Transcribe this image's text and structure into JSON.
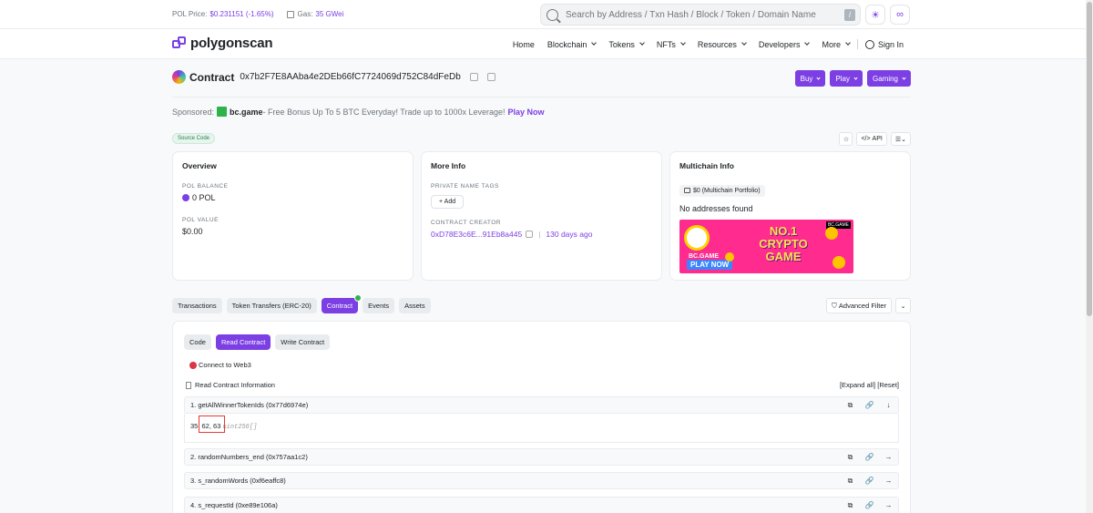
{
  "topbar": {
    "price_label": "POL Price:",
    "price_value": "$0.231151 (-1.65%)",
    "gas_label": "Gas:",
    "gas_value": "35 GWei",
    "search_placeholder": "Search by Address / Txn Hash / Block / Token / Domain Name",
    "search_shortcut": "/"
  },
  "header": {
    "logo": "polygonscan",
    "nav": [
      "Home",
      "Blockchain",
      "Tokens",
      "NFTs",
      "Resources",
      "Developers",
      "More"
    ],
    "signin": "Sign In"
  },
  "contract": {
    "label": "Contract",
    "address": "0x7b2F7E8AAba4e2DEb66fC7724069d752C84dFeDb",
    "actions": [
      "Buy",
      "Play",
      "Gaming"
    ]
  },
  "sponsored": {
    "prefix": "Sponsored:",
    "brand": "bc.game",
    "text": " - Free Bonus Up To 5 BTC Everyday! Trade up to 1000x Leverage!",
    "cta": "Play Now"
  },
  "badge": "Source Code",
  "tools": {
    "api": "API"
  },
  "overview": {
    "title": "Overview",
    "balance_label": "POL BALANCE",
    "balance_value": "0 POL",
    "value_label": "POL VALUE",
    "value_value": "$0.00"
  },
  "more_info": {
    "title": "More Info",
    "tags_label": "PRIVATE NAME TAGS",
    "add_label": "+ Add",
    "creator_label": "CONTRACT CREATOR",
    "creator_addr": "0xD78E3c6E...91Eb8a445",
    "creator_sep": "|",
    "creator_age": "130 days ago"
  },
  "multichain": {
    "title": "Multichain Info",
    "portfolio": "$0 (Multichain Portfolio)",
    "no_addresses": "No addresses found",
    "ad": {
      "brand": "BC.GAME",
      "cta": "PLAY NOW",
      "headline": "NO.1 CRYPTO GAME",
      "tag": "BC.GAME"
    }
  },
  "tabs": [
    "Transactions",
    "Token Transfers (ERC-20)",
    "Contract",
    "Events",
    "Assets"
  ],
  "advanced_filter": "Advanced Filter",
  "panel": {
    "subtabs": [
      "Code",
      "Read Contract",
      "Write Contract"
    ],
    "connect": "Connect to Web3",
    "info": "Read Contract Information",
    "expand": "[Expand all]  [Reset]",
    "functions": [
      "1. getAllWinnerTokenIds (0x77d6974e)",
      "2. randomNumbers_end (0x757aa1c2)",
      "3. s_randomWords (0xf6eaffc8)",
      "4. s_requestId (0xe89e106a)"
    ],
    "result_value": "35, 62, 63",
    "result_type": "uint256[]"
  }
}
